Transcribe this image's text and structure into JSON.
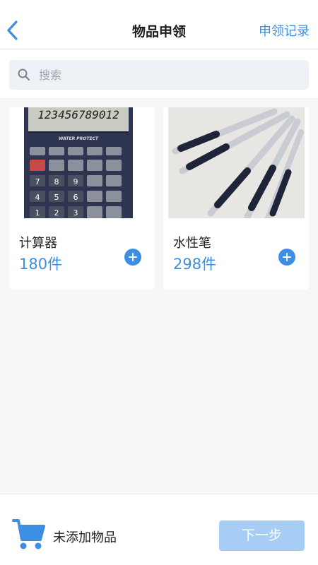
{
  "header": {
    "title": "物品申领",
    "right_action": "申领记录",
    "back_icon": "chevron-left-icon"
  },
  "search": {
    "placeholder": "搜索",
    "value": "",
    "icon": "search-icon"
  },
  "items": [
    {
      "name": "计算器",
      "quantity": "180件",
      "image": "calculator-image",
      "add_icon": "plus-circle-icon"
    },
    {
      "name": "水性笔",
      "quantity": "298件",
      "image": "gel-pens-image",
      "add_icon": "plus-circle-icon"
    }
  ],
  "footer": {
    "cart_icon": "shopping-cart-icon",
    "cart_status": "未添加物品",
    "next_label": "下一步"
  },
  "colors": {
    "accent": "#3d8fe3",
    "button_disabled": "#a8cdf4",
    "background": "#f7f7f8"
  }
}
